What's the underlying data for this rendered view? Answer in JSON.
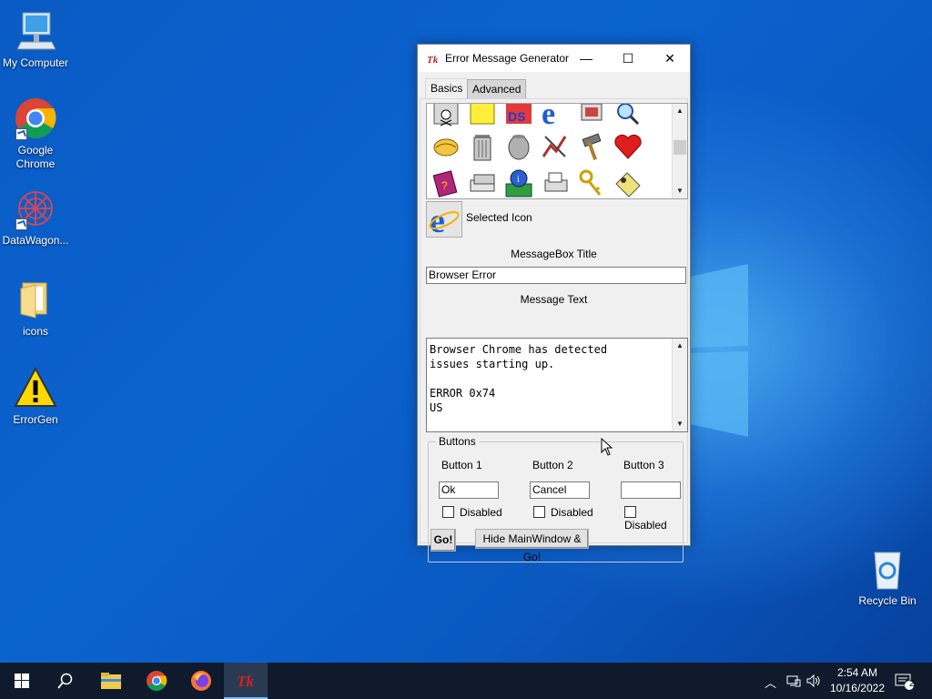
{
  "desktop": {
    "icons": [
      {
        "label": "My Computer"
      },
      {
        "label": "Google Chrome"
      },
      {
        "label": "DataWagon..."
      },
      {
        "label": "icons"
      },
      {
        "label": "ErrorGen"
      },
      {
        "label": "Recycle Bin"
      }
    ]
  },
  "window": {
    "title": "Error Message Generator",
    "minimize": "—",
    "maximize": "☐",
    "close": "✕",
    "tabs": [
      {
        "label": "Basics"
      },
      {
        "label": "Advanced"
      }
    ],
    "selected_icon_label": "Selected Icon",
    "messagebox_title_caption": "MessageBox Title",
    "messagebox_title_value": "Browser Error",
    "message_text_caption": "Message Text",
    "message_text_value": "Browser Chrome has detected\nissues starting up.\n\nERROR 0x74\nUS",
    "buttons_group": {
      "title": "Buttons",
      "button1": {
        "label": "Button 1",
        "value": "Ok",
        "disabled_label": "Disabled"
      },
      "button2": {
        "label": "Button 2",
        "value": "Cancel",
        "disabled_label": "Disabled"
      },
      "button3": {
        "label": "Button 3",
        "value": "",
        "disabled_label": "Disabled"
      }
    },
    "go_button": "Go!",
    "hide_go_button": "Hide MainWindow & Go!",
    "icon_grid": [
      "skull-icon",
      "note-icon",
      "dos-icon",
      "ie-icon",
      "window-stack-icon",
      "magnifier-icon",
      "fortune-cookie-icon",
      "trash-can-icon",
      "jar-icon",
      "graph-icon",
      "hammer-icon",
      "heart-icon",
      "book-icon",
      "disk-drives-icon",
      "network-info-icon",
      "printer-icon",
      "keys-icon",
      "key-card-icon"
    ]
  },
  "taskbar": {
    "time": "2:54 AM",
    "date": "10/16/2022",
    "notification_count": "2",
    "items": [
      "start-button",
      "search-icon",
      "file-explorer-icon",
      "chrome-icon",
      "firefox-icon",
      "errorgen-icon"
    ]
  },
  "colors": {
    "desktop": "#0a5bc4",
    "taskbar": "#0f1b2c",
    "window_bg": "#f0f0f0"
  }
}
